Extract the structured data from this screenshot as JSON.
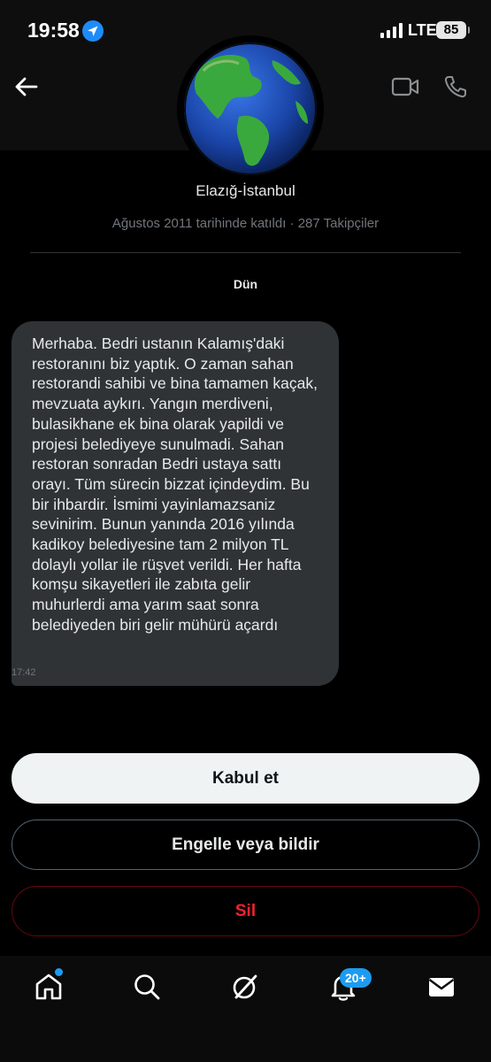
{
  "status": {
    "time": "19:58",
    "network": "LTE",
    "battery": "85"
  },
  "profile": {
    "location": "Elazığ-İstanbul",
    "joined": "Ağustos 2011 tarihinde katıldı · 287 Takipçiler"
  },
  "conversation": {
    "date_label": "Dün",
    "message": {
      "text": "Merhaba. Bedri ustanın Kalamış'daki restoranını biz yaptık. O zaman sahan restorandi sahibi ve bina tamamen kaçak, mevzuata aykırı. Yangın merdiveni, bulasikhane ek bina olarak yapildi ve projesi belediyeye sunulmadi. Sahan restoran sonradan Bedri ustaya sattı orayı. Tüm sürecin bizzat içindeydim. Bu bir ihbardir. İsmimi yayinlamazsaniz sevinirim. Bunun yanında 2016 yılında kadikoy belediyesine tam 2 milyon TL dolaylı yollar ile rüşvet verildi. Her hafta komşu sikayetleri ile zabıta gelir muhurlerdi ama yarım saat sonra belediyeden biri gelir mühürü açardı",
      "time": "17:42"
    }
  },
  "actions": {
    "accept": "Kabul et",
    "block_report": "Engelle veya bildir",
    "delete": "Sil"
  },
  "nav": {
    "items": [
      "home-icon",
      "search-icon",
      "grok-icon",
      "notifications-icon",
      "messages-icon"
    ],
    "notifications_badge": "20+"
  },
  "colors": {
    "accent": "#1d9bf0",
    "danger": "#f4212e",
    "bubble": "#2f3336"
  }
}
